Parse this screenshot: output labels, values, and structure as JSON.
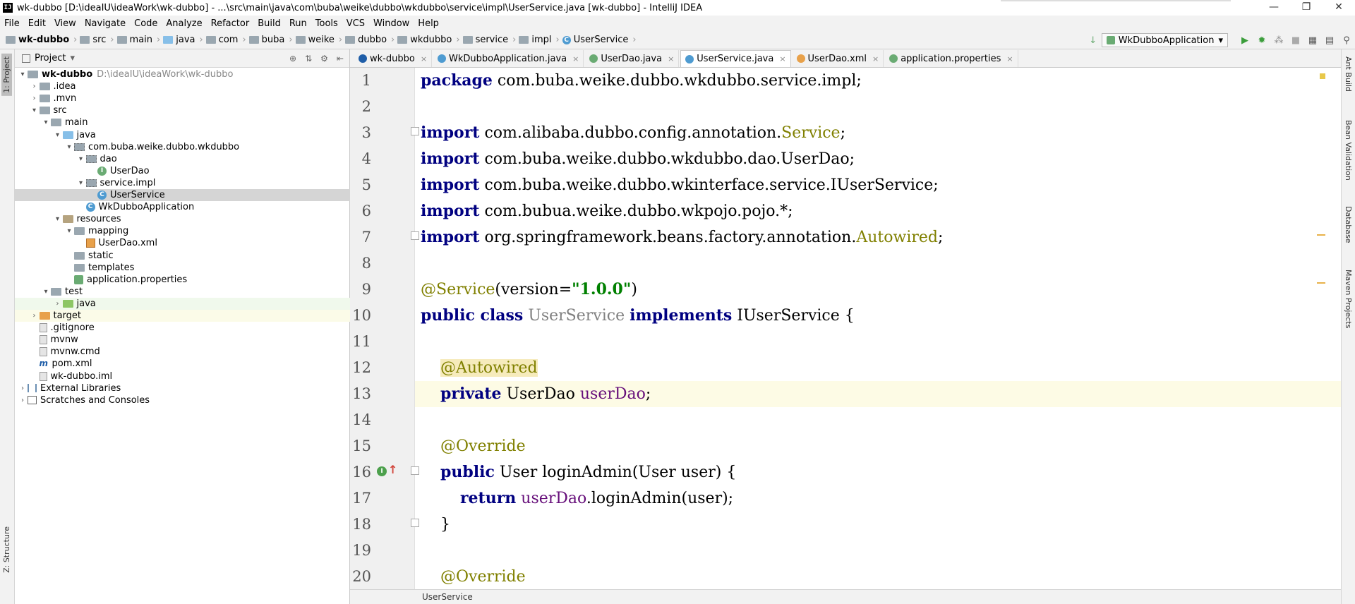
{
  "titlebar": {
    "icon": "IJ",
    "title": "wk-dubbo [D:\\ideaIU\\ideaWork\\wk-dubbo] - ...\\src\\main\\java\\com\\buba\\weike\\dubbo\\wkdubbo\\service\\impl\\UserService.java [wk-dubbo] - IntelliJ IDEA",
    "minimize": "—",
    "maximize": "❐",
    "close": "✕"
  },
  "menu": [
    "File",
    "Edit",
    "View",
    "Navigate",
    "Code",
    "Analyze",
    "Refactor",
    "Build",
    "Run",
    "Tools",
    "VCS",
    "Window",
    "Help"
  ],
  "breadcrumb": [
    "wk-dubbo",
    "src",
    "main",
    "java",
    "com",
    "buba",
    "weike",
    "dubbo",
    "wkdubbo",
    "service",
    "impl",
    "UserService"
  ],
  "run_config": {
    "label": "WkDubboApplication",
    "arrow": "▾",
    "sort_icon": "↓"
  },
  "project_panel": {
    "title": "Project",
    "title_arrow": "▾",
    "tree": [
      {
        "label": "wk-dubbo",
        "path": "D:\\ideaIU\\ideaWork\\wk-dubbo",
        "arrow": "▾",
        "icon": "folder",
        "bold": true
      },
      {
        "label": ".idea",
        "arrow": "›",
        "icon": "folder"
      },
      {
        "label": ".mvn",
        "arrow": "›",
        "icon": "folder"
      },
      {
        "label": "src",
        "arrow": "▾",
        "icon": "folder"
      },
      {
        "label": "main",
        "arrow": "▾",
        "icon": "folder"
      },
      {
        "label": "java",
        "arrow": "▾",
        "icon": "folder-blue"
      },
      {
        "label": "com.buba.weike.dubbo.wkdubbo",
        "arrow": "▾",
        "icon": "package"
      },
      {
        "label": "dao",
        "arrow": "▾",
        "icon": "package"
      },
      {
        "label": "UserDao",
        "arrow": "",
        "icon": "interface"
      },
      {
        "label": "service.impl",
        "arrow": "▾",
        "icon": "package"
      },
      {
        "label": "UserService",
        "arrow": "",
        "icon": "class",
        "selected": true
      },
      {
        "label": "WkDubboApplication",
        "arrow": "",
        "icon": "class"
      },
      {
        "label": "resources",
        "arrow": "▾",
        "icon": "folder-res"
      },
      {
        "label": "mapping",
        "arrow": "▾",
        "icon": "folder"
      },
      {
        "label": "UserDao.xml",
        "arrow": "",
        "icon": "xml"
      },
      {
        "label": "static",
        "arrow": "",
        "icon": "folder"
      },
      {
        "label": "templates",
        "arrow": "",
        "icon": "folder"
      },
      {
        "label": "application.properties",
        "arrow": "",
        "icon": "props"
      },
      {
        "label": "test",
        "arrow": "▾",
        "icon": "folder"
      },
      {
        "label": "java",
        "arrow": "›",
        "icon": "folder-green",
        "bg": "test"
      },
      {
        "label": "target",
        "arrow": "›",
        "icon": "folder-orange",
        "bg": "target"
      },
      {
        "label": ".gitignore",
        "arrow": "",
        "icon": "file"
      },
      {
        "label": "mvnw",
        "arrow": "",
        "icon": "file"
      },
      {
        "label": "mvnw.cmd",
        "arrow": "",
        "icon": "file"
      },
      {
        "label": "pom.xml",
        "arrow": "",
        "icon": "maven"
      },
      {
        "label": "wk-dubbo.iml",
        "arrow": "",
        "icon": "file"
      },
      {
        "label": "External Libraries",
        "arrow": "›",
        "icon": "library"
      },
      {
        "label": "Scratches and Consoles",
        "arrow": "›",
        "icon": "scratch"
      }
    ]
  },
  "left_tabs": {
    "project": "1: Project",
    "structure": "Z: Structure"
  },
  "right_tabs": {
    "ant": "Ant Build",
    "bean": "Bean Validation",
    "database": "Database",
    "maven": "Maven Projects"
  },
  "tabs": [
    {
      "label": "wk-dubbo",
      "icon_color": "#1f5ea8",
      "active": false
    },
    {
      "label": "WkDubboApplication.java",
      "icon_color": "#4e9bd1",
      "active": false
    },
    {
      "label": "UserDao.java",
      "icon_color": "#6aab73",
      "active": false
    },
    {
      "label": "UserService.java",
      "icon_color": "#4e9bd1",
      "active": true
    },
    {
      "label": "UserDao.xml",
      "icon_color": "#e8a14a",
      "active": false
    },
    {
      "label": "application.properties",
      "icon_color": "#6aab73",
      "active": false
    }
  ],
  "code": {
    "line_numbers": [
      "1",
      "2",
      "3",
      "4",
      "5",
      "6",
      "7",
      "8",
      "9",
      "10",
      "11",
      "12",
      "13",
      "14",
      "15",
      "16",
      "17",
      "18",
      "19",
      "20"
    ],
    "current_line": "13"
  },
  "statusbar": {
    "breadcrumb": "UserService"
  },
  "colors": {
    "keyword": "#000080",
    "annotation": "#808000",
    "string": "#008000",
    "field": "#660e7a",
    "current_line": "#fdfbe5"
  }
}
